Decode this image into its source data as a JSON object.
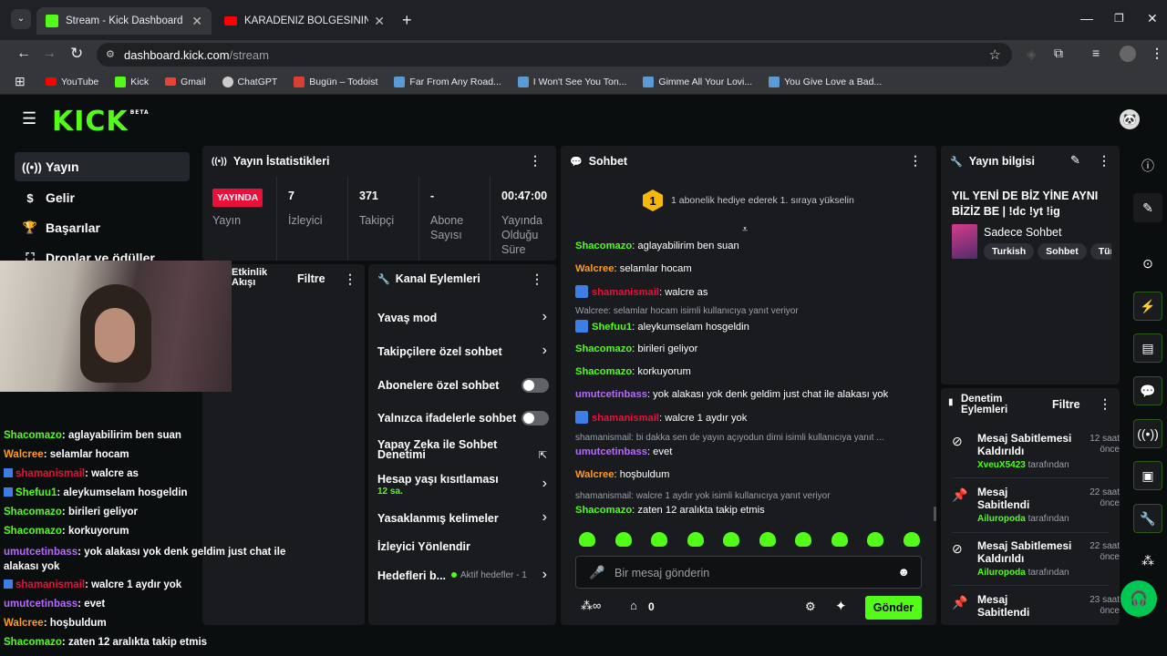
{
  "browser": {
    "tabs": [
      {
        "title": "Stream - Kick Dashboard",
        "fav_color": "#53fc18"
      },
      {
        "title": "KARADENİZ BÖLGESİNİN EN Ç",
        "fav_color": "#ff0000"
      }
    ],
    "url_host": "dashboard.kick.com",
    "url_path": "/stream",
    "bookmarks": [
      {
        "label": "YouTube",
        "color": "#ff0000"
      },
      {
        "label": "Kick",
        "color": "#53fc18"
      },
      {
        "label": "Gmail",
        "color": "#ea4335"
      },
      {
        "label": "ChatGPT",
        "color": "#cccccc"
      },
      {
        "label": "Bugün – Todoist",
        "color": "#db4035"
      },
      {
        "label": "Far From Any Road...",
        "color": "#5b9bd5"
      },
      {
        "label": "I Won't See You Ton...",
        "color": "#5b9bd5"
      },
      {
        "label": "Gimme All Your Lovi...",
        "color": "#5b9bd5"
      },
      {
        "label": "You Give Love a Bad...",
        "color": "#5b9bd5"
      }
    ]
  },
  "kick": {
    "logo": "KICK",
    "logo_badge": "BETA"
  },
  "sidebar": {
    "items": [
      {
        "label": "Yayın",
        "icon": "broadcast-icon"
      },
      {
        "label": "Gelir",
        "icon": "dollar-icon"
      },
      {
        "label": "Başarılar",
        "icon": "trophy-icon"
      },
      {
        "label": "Droplar ve ödüller",
        "icon": "gift-icon"
      }
    ]
  },
  "stats": {
    "title": "Yayın İstatistikleri",
    "live_badge": "YAYINDA",
    "live_label": "Yayın",
    "viewers_value": "7",
    "viewers_label": "İzleyici",
    "followers_value": "371",
    "followers_label": "Takipçi",
    "subs_value": "-",
    "subs_label": "Abone Sayısı",
    "uptime_value": "00:47:00",
    "uptime_label": "Yayında Olduğu Süre"
  },
  "activity": {
    "title": "Etkinlik Akışı",
    "filter": "Filtre"
  },
  "channel_actions": {
    "title": "Kanal Eylemleri",
    "slow_mode": "Yavaş mod",
    "followers_only": "Takipçilere özel sohbet",
    "subs_only": "Abonelere özel sohbet",
    "emotes_only": "Yalnızca ifadelerle sohbet",
    "ai_moderation": "Yapay Zeka ile Sohbet Denetimi",
    "age_restriction": "Hesap yaşı kısıtlaması",
    "age_value": "12 sa.",
    "banned_words": "Yasaklanmış kelimeler",
    "redirect": "İzleyici Yönlendir",
    "goals": "Hedefleri b...",
    "goals_status": "Aktif hedefler - 1"
  },
  "chat": {
    "title": "Sohbet",
    "gift_rank": "1",
    "gift_prompt": "1 abonelik hediye ederek 1. sıraya yükselin",
    "messages": [
      {
        "user": "Shacomazo",
        "color": "#53fc18",
        "text": "aglayabilirim ben suan"
      },
      {
        "user": "Walcree",
        "color": "#ff9a1f",
        "text": "selamlar hocam"
      },
      {
        "user": "shamanismail",
        "color": "#e9113c",
        "text": "walcre as",
        "badge": true
      },
      {
        "reply": "Walcree: selamlar hocam isimli kullanıcıya yanıt veriyor"
      },
      {
        "user": "Shefuu1",
        "color": "#53fc18",
        "text": "aleykumselam hosgeldin",
        "badge": true
      },
      {
        "user": "Shacomazo",
        "color": "#53fc18",
        "text": "birileri geliyor"
      },
      {
        "user": "Shacomazo",
        "color": "#53fc18",
        "text": "korkuyorum"
      },
      {
        "user": "umutcetinbass",
        "color": "#b968fe",
        "text": "yok alakası yok denk geldim just chat ile alakası yok"
      },
      {
        "user": "shamanismail",
        "color": "#e9113c",
        "text": "walcre 1 aydır yok",
        "badge": true
      },
      {
        "reply": "shamanismail: bi dakka sen de yayın açıyodun dimi isimli kullanıcıya yanıt ..."
      },
      {
        "user": "umutcetinbass",
        "color": "#b968fe",
        "text": "evet"
      },
      {
        "user": "Walcree",
        "color": "#ff9a1f",
        "text": "hoşbuldum"
      },
      {
        "reply": "shamanismail: walcre 1 aydır yok isimli kullanıcıya yanıt veriyor"
      },
      {
        "user": "Shacomazo",
        "color": "#53fc18",
        "text": "zaten 12 aralıkta takip etmis"
      }
    ],
    "input_placeholder": "Bir mesaj gönderin",
    "points": "0",
    "send": "Gönder"
  },
  "overlay_chat": {
    "messages": [
      {
        "user": "Shacomazo",
        "color": "#53fc18",
        "text": "aglayabilirim ben suan"
      },
      {
        "user": "Walcree",
        "color": "#ff9a1f",
        "text": "selamlar hocam"
      },
      {
        "user": "shamanismail",
        "color": "#e9113c",
        "text": "walcre as",
        "badge": true
      },
      {
        "user": "Shefuu1",
        "color": "#53fc18",
        "text": "aleykumselam hosgeldin",
        "badge": true
      },
      {
        "user": "Shacomazo",
        "color": "#53fc18",
        "text": "birileri geliyor"
      },
      {
        "user": "Shacomazo",
        "color": "#53fc18",
        "text": "korkuyorum"
      },
      {
        "user": "umutcetinbass",
        "color": "#b968fe",
        "text": "yok alakası yok denk geldim just chat ile alakası yok"
      },
      {
        "user": "shamanismail",
        "color": "#e9113c",
        "text": "walcre 1 aydır yok",
        "badge": true
      },
      {
        "user": "umutcetinbass",
        "color": "#b968fe",
        "text": "evet"
      },
      {
        "user": "Walcree",
        "color": "#ff9a1f",
        "text": "hoşbuldum"
      },
      {
        "user": "Shacomazo",
        "color": "#53fc18",
        "text": "zaten 12 aralıkta takip etmis"
      }
    ]
  },
  "stream_info": {
    "title_label": "Yayın bilgisi",
    "stream_title": "YIL YENİ DE BİZ YİNE AYNI BİZİZ BE | !dc !yt !ig",
    "category": "Sadece Sohbet",
    "tags": [
      "Turkish",
      "Sohbet",
      "Türk"
    ]
  },
  "moderation": {
    "title": "Denetim Eylemleri",
    "filter": "Filtre",
    "items": [
      {
        "action": "Mesaj Sabitlemesi Kaldırıldı",
        "by": "XveuX5423",
        "by_suffix": "tarafından",
        "time": "12 saat önce",
        "icon": "unpin-icon"
      },
      {
        "action": "Mesaj Sabitlendi",
        "by": "Ailuropoda",
        "by_suffix": "tarafından",
        "time": "22 saat önce",
        "icon": "pin-icon"
      },
      {
        "action": "Mesaj Sabitlemesi Kaldırıldı",
        "by": "Ailuropoda",
        "by_suffix": "tarafından",
        "time": "22 saat önce",
        "icon": "unpin-icon"
      },
      {
        "action": "Mesaj Sabitlendi",
        "by": "",
        "by_suffix": "",
        "time": "23 saat önce",
        "icon": "pin-icon"
      }
    ]
  },
  "colors": {
    "accent": "#53fc18",
    "panel": "#191b1f",
    "bg": "#0b0e0f"
  }
}
